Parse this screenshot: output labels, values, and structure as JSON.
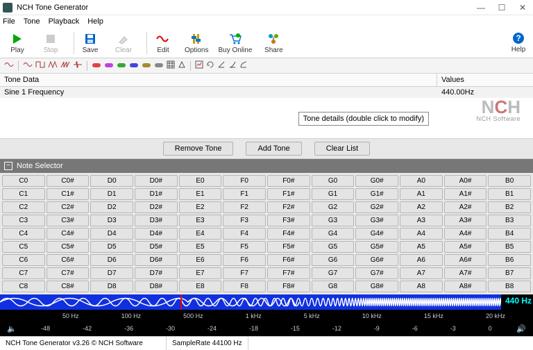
{
  "window": {
    "title": "NCH Tone Generator"
  },
  "menu": {
    "file": "File",
    "tone": "Tone",
    "playback": "Playback",
    "help": "Help"
  },
  "toolbar": {
    "play": "Play",
    "stop": "Stop",
    "save": "Save",
    "clear": "Clear",
    "edit": "Edit",
    "options": "Options",
    "buy": "Buy Online",
    "share": "Share",
    "help": "Help"
  },
  "grid": {
    "tone_data_header": "Tone Data",
    "values_header": "Values",
    "row1_name": "Sine 1 Frequency",
    "row1_value": "440.00Hz",
    "tooltip": "Tone details (double click to modify)"
  },
  "watermark": {
    "n": "N",
    "c": "C",
    "h": "H",
    "sub": "NCH Software"
  },
  "buttons": {
    "remove": "Remove Tone",
    "add": "Add Tone",
    "clearlist": "Clear List"
  },
  "note_selector": {
    "title": "Note Selector",
    "rows": [
      [
        "C0",
        "C0#",
        "D0",
        "D0#",
        "E0",
        "F0",
        "F0#",
        "G0",
        "G0#",
        "A0",
        "A0#",
        "B0"
      ],
      [
        "C1",
        "C1#",
        "D1",
        "D1#",
        "E1",
        "F1",
        "F1#",
        "G1",
        "G1#",
        "A1",
        "A1#",
        "B1"
      ],
      [
        "C2",
        "C2#",
        "D2",
        "D2#",
        "E2",
        "F2",
        "F2#",
        "G2",
        "G2#",
        "A2",
        "A2#",
        "B2"
      ],
      [
        "C3",
        "C3#",
        "D3",
        "D3#",
        "E3",
        "F3",
        "F3#",
        "G3",
        "G3#",
        "A3",
        "A3#",
        "B3"
      ],
      [
        "C4",
        "C4#",
        "D4",
        "D4#",
        "E4",
        "F4",
        "F4#",
        "G4",
        "G4#",
        "A4",
        "A4#",
        "B4"
      ],
      [
        "C5",
        "C5#",
        "D5",
        "D5#",
        "E5",
        "F5",
        "F5#",
        "G5",
        "G5#",
        "A5",
        "A5#",
        "B5"
      ],
      [
        "C6",
        "C6#",
        "D6",
        "D6#",
        "E6",
        "F6",
        "F6#",
        "G6",
        "G6#",
        "A6",
        "A6#",
        "B6"
      ],
      [
        "C7",
        "C7#",
        "D7",
        "D7#",
        "E7",
        "F7",
        "F7#",
        "G7",
        "G7#",
        "A7",
        "A7#",
        "B7"
      ],
      [
        "C8",
        "C8#",
        "D8",
        "D8#",
        "E8",
        "F8",
        "F8#",
        "G8",
        "G8#",
        "A8",
        "A8#",
        "B8"
      ]
    ]
  },
  "freq_slider": {
    "readout": "440 Hz",
    "ticks": [
      "50 Hz",
      "100 Hz",
      "500 Hz",
      "1 kHz",
      "5 kHz",
      "10 kHz",
      "15 kHz",
      "20 kHz"
    ]
  },
  "vol_slider": {
    "ticks": [
      "-48",
      "-42",
      "-36",
      "-30",
      "-24",
      "-18",
      "-15",
      "-12",
      "-9",
      "-6",
      "-3",
      "0"
    ]
  },
  "status": {
    "app": "NCH Tone Generator v3.26 © NCH Software",
    "rate": "SampleRate 44100 Hz"
  }
}
